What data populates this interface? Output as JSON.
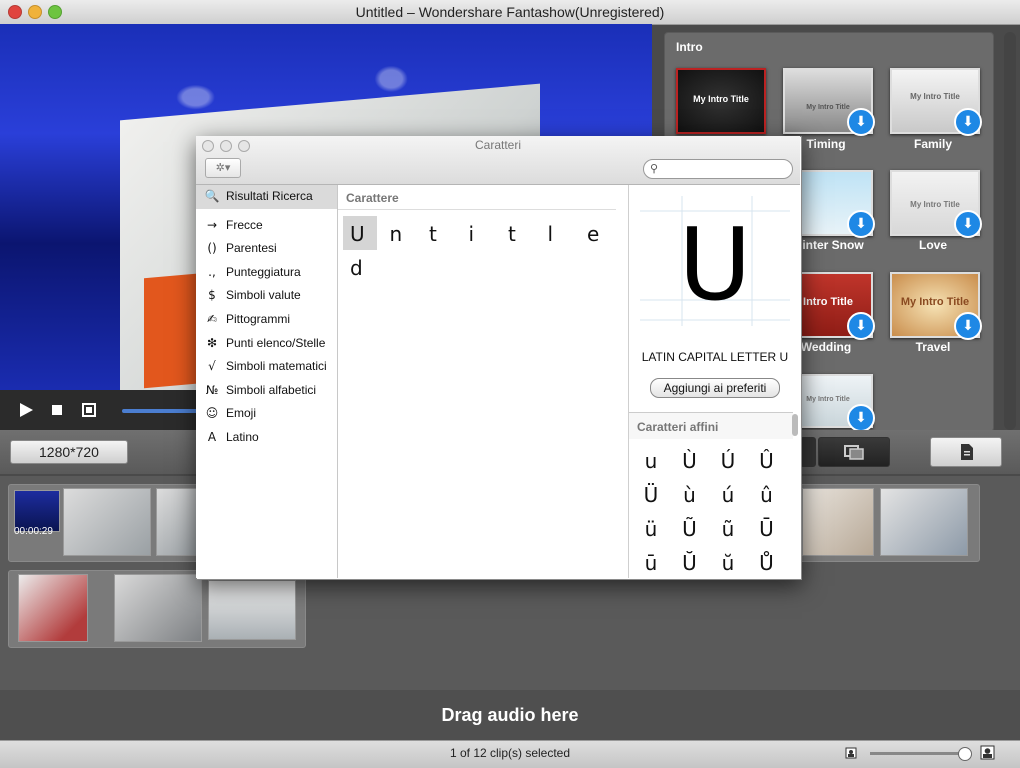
{
  "window": {
    "title": "Untitled – Wondershare Fantashow(Unregistered)"
  },
  "intro_panel": {
    "label": "Intro",
    "templates": [
      {
        "name": "",
        "thumb_text": "My Intro Title",
        "downloadable": false
      },
      {
        "name": "Timing",
        "thumb_text": "My Intro Title",
        "downloadable": true
      },
      {
        "name": "Family",
        "thumb_text": "My Intro Title",
        "downloadable": true
      },
      {
        "name": "inter Snow",
        "thumb_text": "",
        "downloadable": true
      },
      {
        "name": "Love",
        "thumb_text": "My Intro Title",
        "downloadable": true
      },
      {
        "name": "Wedding",
        "thumb_text": "Intro Title",
        "downloadable": true
      },
      {
        "name": "Travel",
        "thumb_text": "My Intro Title",
        "downloadable": true
      },
      {
        "name": "",
        "thumb_text": "My Intro Title",
        "downloadable": true
      }
    ]
  },
  "toolbar": {
    "resolution": "1280*720"
  },
  "storyboard": {
    "first_clip_duration": "00:00:29"
  },
  "audio": {
    "label": "Drag audio here"
  },
  "status": {
    "text": "1 of 12 clip(s) selected"
  },
  "character_viewer": {
    "title": "Caratteri",
    "gear_label": "✲▾",
    "search_placeholder": "",
    "categories": [
      {
        "icon": "magnifier-icon",
        "glyph": "🔍",
        "label": "Risultati Ricerca",
        "selected": true
      },
      {
        "icon": "arrow-icon",
        "glyph": "→",
        "label": "Frecce"
      },
      {
        "icon": "parentheses-icon",
        "glyph": "()",
        "label": "Parentesi"
      },
      {
        "icon": "punctuation-icon",
        "glyph": ".,",
        "label": "Punteggiatura"
      },
      {
        "icon": "dollar-icon",
        "glyph": "$",
        "label": "Simboli valute"
      },
      {
        "icon": "pictogram-icon",
        "glyph": "✍",
        "label": "Pittogrammi"
      },
      {
        "icon": "asterisk-icon",
        "glyph": "❇",
        "label": "Punti elenco/Stelle"
      },
      {
        "icon": "sqrt-icon",
        "glyph": "√",
        "label": "Simboli matematici"
      },
      {
        "icon": "numero-icon",
        "glyph": "№",
        "label": "Simboli alfabetici"
      },
      {
        "icon": "smiley-icon",
        "glyph": "☺",
        "label": "Emoji"
      },
      {
        "icon": "latin-a-icon",
        "glyph": "A",
        "label": "Latino"
      }
    ],
    "grid_header": "Carattere",
    "grid_chars": [
      "U",
      "n",
      "t",
      "i",
      "t",
      "l",
      "e",
      "d"
    ],
    "selected_char": "U",
    "char_name": "LATIN CAPITAL LETTER U",
    "add_favorites": "Aggiungi ai preferiti",
    "related_header": "Caratteri affini",
    "related_chars": [
      "u",
      "Ù",
      "Ú",
      "Û",
      "Ü",
      "ù",
      "ú",
      "û",
      "ü",
      "Ũ",
      "ũ",
      "Ū",
      "ū",
      "Ŭ",
      "ŭ",
      "Ů"
    ]
  }
}
